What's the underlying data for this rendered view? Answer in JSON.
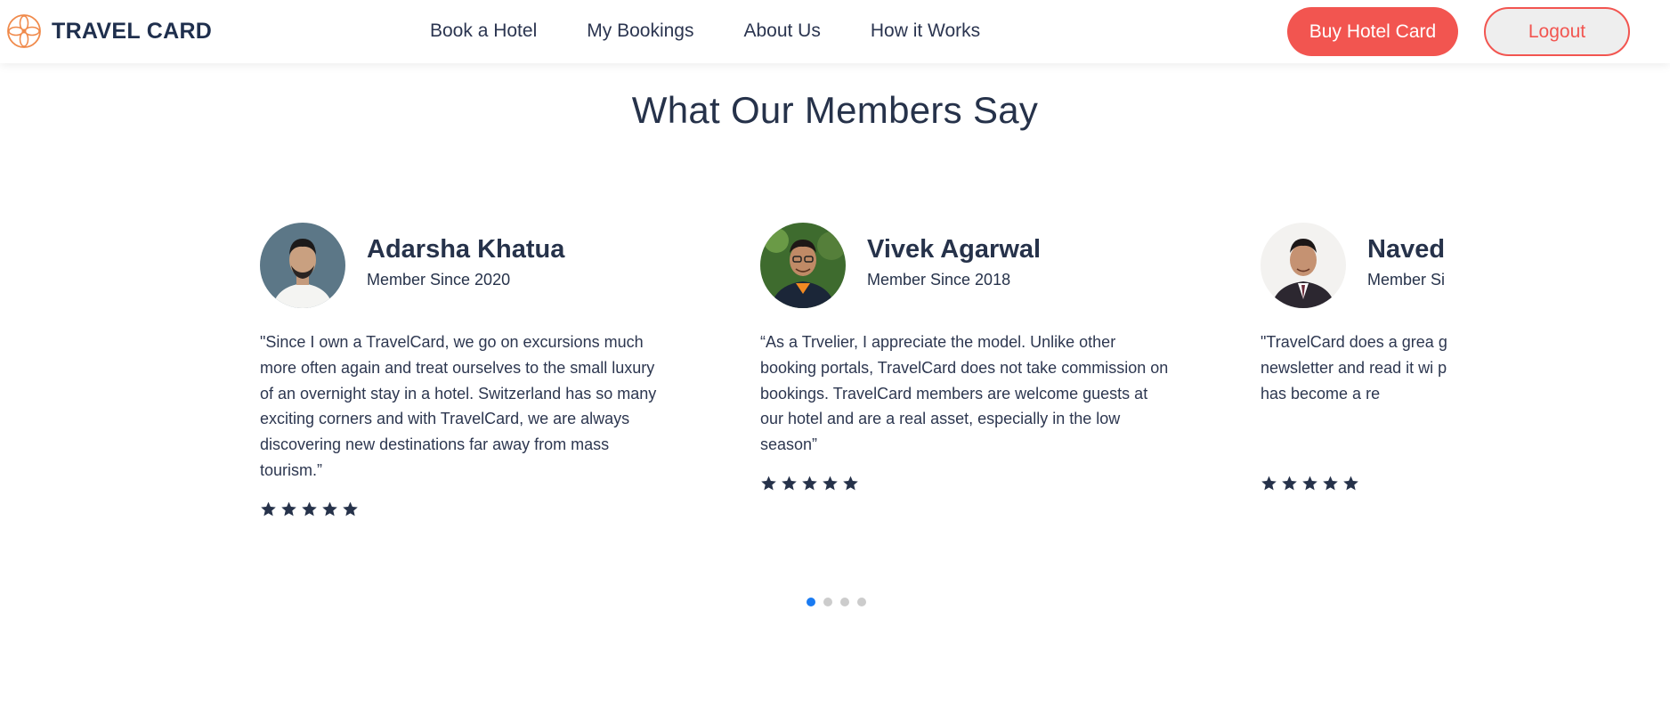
{
  "header": {
    "logo_text": "TRAVEL CARD",
    "nav": [
      "Book a Hotel",
      "My Bookings",
      "About Us",
      "How it Works"
    ],
    "buy_label": "Buy Hotel Card",
    "logout_label": "Logout"
  },
  "section": {
    "title": "What Our Members Say"
  },
  "testimonials": [
    {
      "name": "Adarsha Khatua",
      "member_since": "Member Since 2020",
      "quote": "\"Since I own a TravelCard, we go on excursions much more often again and treat ourselves to the small luxury of an overnight stay in a hotel. Switzerland has so many exciting corners and with TravelCard, we are always discovering new destinations far away from mass tourism.”",
      "rating": 5
    },
    {
      "name": "Vivek Agarwal",
      "member_since": "Member Since 2018",
      "quote": "“As a Trvelier, I appreciate the model. Unlike other booking portals, TravelCard does not take commission on bookings. TravelCard members are welcome guests at our hotel and are a real asset, especially in the low season”",
      "rating": 5
    },
    {
      "name": "Naved",
      "member_since": "Member Si",
      "quote": "\"TravelCard does a grea great hotel offers. I alwa newsletter and read it wi pandemic times, discove to offer has become a re",
      "rating": 5
    }
  ],
  "carousel": {
    "page_count": 4,
    "active_index": 0
  },
  "colors": {
    "accent": "#f25550",
    "text": "#26324a",
    "dot_active": "#1a7bf2",
    "dot_inactive": "#cccccc"
  },
  "icons": {
    "logo": "flower-logo-icon",
    "rating": "star-icon"
  }
}
